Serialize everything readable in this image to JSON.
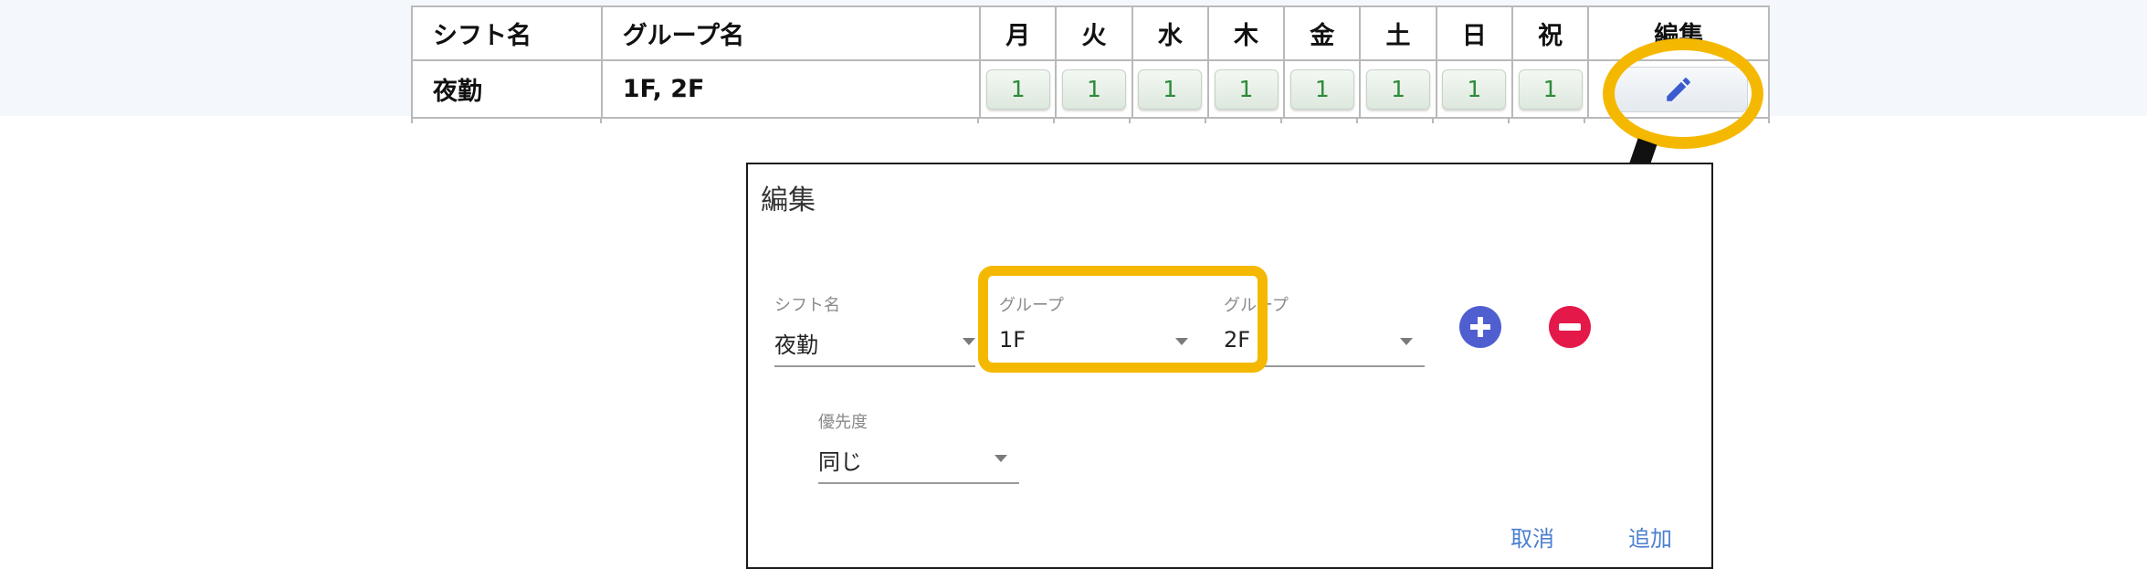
{
  "table": {
    "headers": {
      "shift_name": "シフト名",
      "group_name": "グループ名",
      "days": [
        "月",
        "火",
        "水",
        "木",
        "金",
        "土",
        "日",
        "祝"
      ],
      "edit": "編集"
    },
    "row": {
      "shift_name": "夜勤",
      "group_name": "1F, 2F",
      "counts": [
        "1",
        "1",
        "1",
        "1",
        "1",
        "1",
        "1",
        "1"
      ]
    },
    "edit_icon": "pencil-icon"
  },
  "dialog": {
    "title": "編集",
    "shift_field": {
      "label": "シフト名",
      "value": "夜勤"
    },
    "group_fields": [
      {
        "label": "グループ",
        "value": "1F"
      },
      {
        "label": "グループ",
        "value": "2F"
      }
    ],
    "priority_field": {
      "label": "優先度",
      "value": "同じ"
    },
    "add_group_icon": "plus-circle-icon",
    "remove_group_icon": "minus-circle-icon",
    "cancel_label": "取消",
    "confirm_label": "追加"
  },
  "colors": {
    "highlight": "#f5b800",
    "add_button": "#4f5fd0",
    "remove_button": "#e5184a",
    "count_text": "#2e8b3a",
    "action_text": "#4a7fd0",
    "pencil": "#3a5bd0"
  }
}
